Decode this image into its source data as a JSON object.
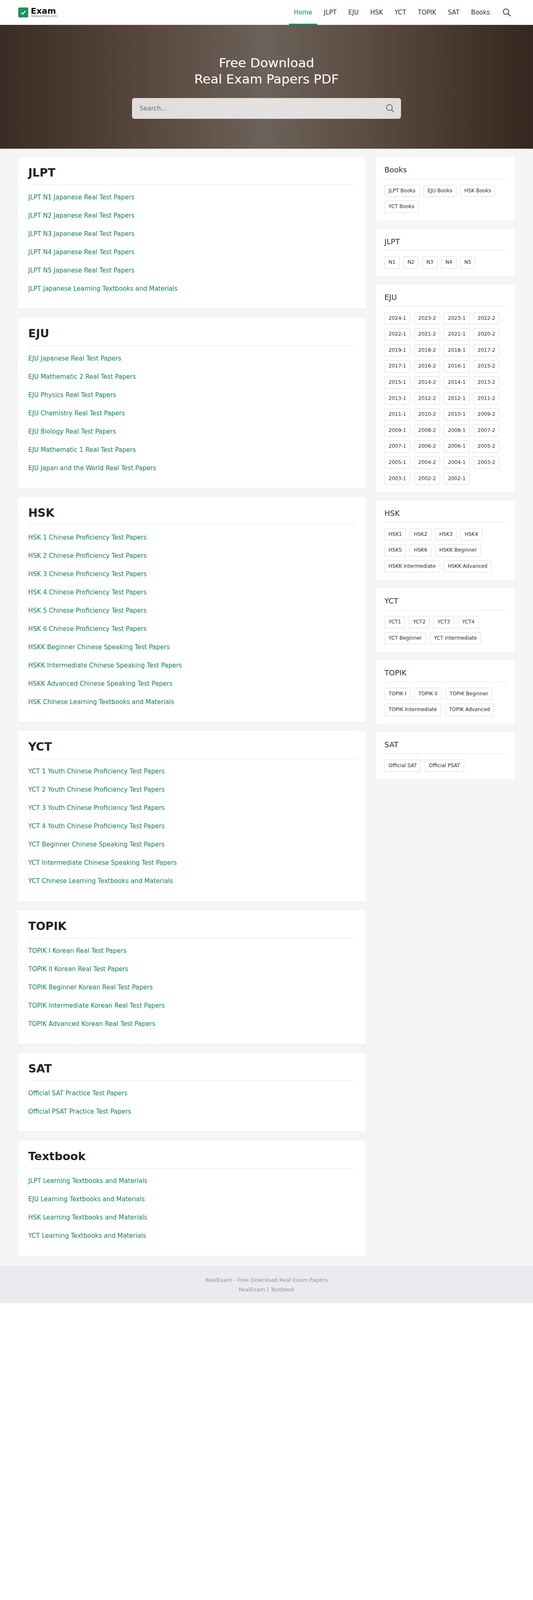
{
  "brand": {
    "name": "Exam",
    "tagline": "realexamtest.com"
  },
  "nav": [
    {
      "label": "Home",
      "selected": true
    },
    {
      "label": "JLPT",
      "selected": false
    },
    {
      "label": "EJU",
      "selected": false
    },
    {
      "label": "HSK",
      "selected": false
    },
    {
      "label": "YCT",
      "selected": false
    },
    {
      "label": "TOPIK",
      "selected": false
    },
    {
      "label": "SAT",
      "selected": false
    },
    {
      "label": "Books",
      "selected": false
    }
  ],
  "hero": {
    "title_lines": [
      "Free Download",
      "Real Exam Papers PDF"
    ],
    "placeholder": "Search..."
  },
  "sections": [
    {
      "title": "JLPT",
      "links": [
        "JLPT N1 Japanese Real Test Papers",
        "JLPT N2 Japanese Real Test Papers",
        "JLPT N3 Japanese Real Test Papers",
        "JLPT N4 Japanese Real Test Papers",
        "JLPT N5 Japanese Real Test Papers",
        "JLPT Japanese Learning Textbooks and Materials"
      ]
    },
    {
      "title": "EJU",
      "links": [
        "EJU Japanese Real Test Papers",
        "EJU Mathematic 2 Real Test Papers",
        "EJU Physics Real Test Papers",
        "EJU Chemistry Real Test Papers",
        "EJU Biology Real Test Papers",
        "EJU Mathematic 1 Real Test Papers",
        "EJU Japan and the World Real Test Papers"
      ]
    },
    {
      "title": "HSK",
      "links": [
        "HSK 1 Chinese Proficiency Test Papers",
        "HSK 2 Chinese Proficiency Test Papers",
        "HSK 3 Chinese Proficiency Test Papers",
        "HSK 4 Chinese Proficiency Test Papers",
        "HSK 5 Chinese Proficiency Test Papers",
        "HSK 6 Chinese Proficiency Test Papers",
        "HSKK Beginner Chinese Speaking Test Papers",
        "HSKK Intermediate Chinese Speaking Test Papers",
        "HSKK Advanced Chinese Speaking Test Papers",
        "HSK Chinese Learning Textbooks and Materials"
      ]
    },
    {
      "title": "YCT",
      "links": [
        "YCT 1 Youth Chinese Proficiency Test Papers",
        "YCT 2 Youth Chinese Proficiency Test Papers",
        "YCT 3 Youth Chinese Proficiency Test Papers",
        "YCT 4 Youth Chinese Proficiency Test Papers",
        "YCT Beginner Chinese Speaking Test Papers",
        "YCT Intermediate Chinese Speaking Test Papers",
        "YCT Chinese Learning Textbooks and Materials"
      ]
    },
    {
      "title": "TOPIK",
      "links": [
        "TOPIK I Korean Real Test Papers",
        "TOPIK II Korean Real Test Papers",
        "TOPIK Beginner Korean Real Test Papers",
        "TOPIK Intermediate Korean Real Test Papers",
        "TOPIK Advanced Korean Real Test Papers"
      ]
    },
    {
      "title": "SAT",
      "links": [
        "Official SAT Practice Test Papers",
        "Official PSAT Practice Test Papers"
      ]
    },
    {
      "title": "Textbook",
      "links": [
        "JLPT Learning Textbooks and Materials",
        "EJU Learning Textbooks and Materials",
        "HSK Learning Textbooks and Materials",
        "YCT Learning Textbooks and Materials"
      ]
    }
  ],
  "sidebar": [
    {
      "title": "Books",
      "tags": [
        "JLPT Books",
        "EJU Books",
        "HSK Books",
        "YCT Books"
      ]
    },
    {
      "title": "JLPT",
      "tags": [
        "N1",
        "N2",
        "N3",
        "N4",
        "N5"
      ]
    },
    {
      "title": "EJU",
      "tags": [
        "2024-1",
        "2023-2",
        "2023-1",
        "2022-2",
        "2022-1",
        "2021-2",
        "2021-1",
        "2020-2",
        "2019-1",
        "2018-2",
        "2018-1",
        "2017-2",
        "2017-1",
        "2016-2",
        "2016-1",
        "2015-2",
        "2015-1",
        "2014-2",
        "2014-1",
        "2013-2",
        "2013-1",
        "2012-2",
        "2012-1",
        "2011-2",
        "2011-1",
        "2010-2",
        "2010-1",
        "2009-2",
        "2009-1",
        "2008-2",
        "2008-1",
        "2007-2",
        "2007-1",
        "2006-2",
        "2006-1",
        "2005-2",
        "2005-1",
        "2004-2",
        "2004-1",
        "2003-2",
        "2003-1",
        "2002-2",
        "2002-1"
      ]
    },
    {
      "title": "HSK",
      "tags": [
        "HSK1",
        "HSK2",
        "HSK3",
        "HSK4",
        "HSK5",
        "HSK6",
        "HSKK Beginner",
        "HSKK Intermediate",
        "HSKK Advanced"
      ]
    },
    {
      "title": "YCT",
      "tags": [
        "YCT1",
        "YCT2",
        "YCT3",
        "YCT4",
        "YCT Beginner",
        "YCT Intermediate"
      ]
    },
    {
      "title": "TOPIK",
      "tags": [
        "TOPIK I",
        "TOPIK II",
        "TOPIK Beginner",
        "TOPIK Intermediate",
        "TOPIK Advanced"
      ]
    },
    {
      "title": "SAT",
      "tags": [
        "Official SAT",
        "Official PSAT"
      ]
    }
  ],
  "footer": {
    "line": "RealExam - Free Download Real Exam Papers",
    "links": [
      "RealExam",
      "Textbook"
    ],
    "separator": "|"
  }
}
